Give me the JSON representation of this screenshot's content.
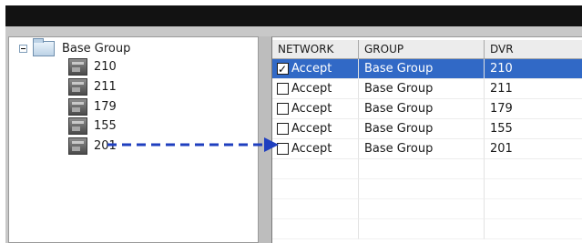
{
  "tree": {
    "root_label": "Base Group",
    "items": [
      {
        "label": "210",
        "icon": "dvr-icon"
      },
      {
        "label": "211",
        "icon": "dvr-icon"
      },
      {
        "label": "179",
        "icon": "dvr-icon"
      },
      {
        "label": "155",
        "icon": "dvr-icon"
      },
      {
        "label": "201",
        "icon": "dvr-icon"
      }
    ]
  },
  "grid": {
    "columns": [
      "NETWORK",
      "GROUP",
      "DVR"
    ],
    "rows": [
      {
        "network": "Accept",
        "checked": true,
        "group": "Base Group",
        "dvr": "210",
        "selected": true
      },
      {
        "network": "Accept",
        "checked": false,
        "group": "Base Group",
        "dvr": "211",
        "selected": false
      },
      {
        "network": "Accept",
        "checked": false,
        "group": "Base Group",
        "dvr": "179",
        "selected": false
      },
      {
        "network": "Accept",
        "checked": false,
        "group": "Base Group",
        "dvr": "155",
        "selected": false
      },
      {
        "network": "Accept",
        "checked": false,
        "group": "Base Group",
        "dvr": "201",
        "selected": false
      }
    ]
  },
  "colors": {
    "selection": "#3169c6",
    "arrow": "#1f3fbf",
    "titlebar": "#121212"
  }
}
